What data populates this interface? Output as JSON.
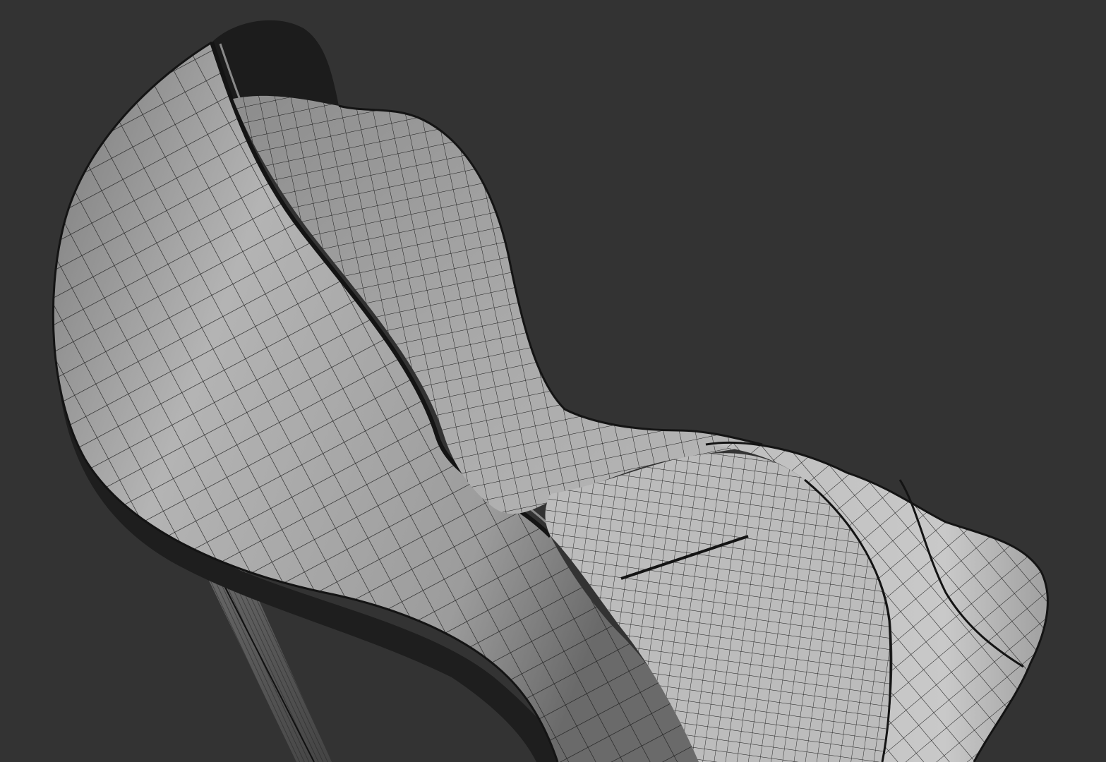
{
  "viewport": {
    "background_color": "#333333",
    "mesh_shade_light": "#c9c9c9",
    "mesh_shade_mid": "#9a9a9a",
    "mesh_shade_dark": "#5a5a5a",
    "wire_color": "#1a1a1a"
  },
  "model": {
    "object": "high-heel-shoe",
    "display_mode": "shaded-wireframe"
  }
}
